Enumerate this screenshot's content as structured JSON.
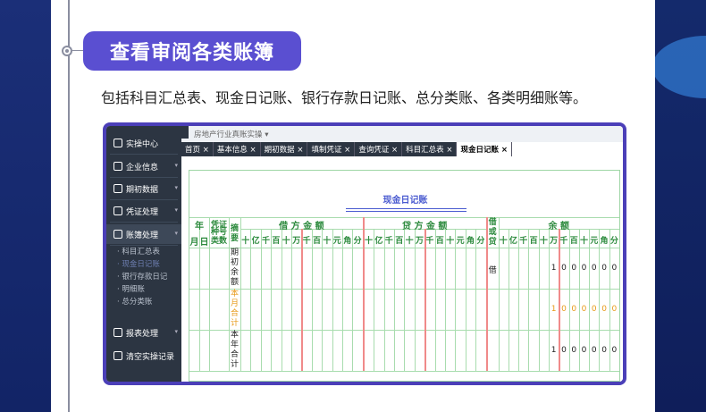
{
  "section": {
    "title": "查看审阅各类账簿",
    "description": "包括科目汇总表、现金日记账、银行存款日记账、总分类账、各类明细账等。"
  },
  "colors": {
    "pill": "#5a4fd1",
    "frame": "#4b3fb8",
    "sidebar": "#2c3542",
    "header_green": "#2c8a3d",
    "title_blue": "#4a5bd0",
    "orange": "#e89a1a"
  },
  "app": {
    "sidebar": {
      "items": [
        {
          "label": "实操中心",
          "icon": "monitor-icon",
          "arrow": ""
        },
        {
          "label": "企业信息",
          "icon": "users-icon",
          "arrow": "▾"
        },
        {
          "label": "期初数据",
          "icon": "bar-chart-icon",
          "arrow": "▾"
        },
        {
          "label": "凭证处理",
          "icon": "voucher-icon",
          "arrow": "▾"
        },
        {
          "label": "账簿处理",
          "icon": "book-icon",
          "arrow": "▾"
        }
      ],
      "subitems": [
        "科目汇总表",
        "现金日记账",
        "银行存款日记",
        "明细账",
        "总分类账"
      ],
      "bottom_items": [
        {
          "label": "报表处理",
          "icon": "chart-line-icon",
          "arrow": "▾"
        },
        {
          "label": "清空实操记录",
          "icon": "clear-icon",
          "arrow": ""
        }
      ]
    },
    "breadcrumb": "房地产行业真账实操 ▾",
    "tabs": [
      "首页 ×",
      "基本信息 ×",
      "期初数据 ×",
      "填制凭证 ×",
      "查询凭证 ×",
      "科目汇总表 ×",
      "现金日记账 ×"
    ],
    "ledger": {
      "title": "现金日记账",
      "headers": {
        "year": "年",
        "month": "月",
        "day": "日",
        "voucher": "凭证",
        "voucher_sub": "种号类数",
        "summary": "摘要",
        "debit": "借 方 金 额",
        "credit": "贷 方 金 额",
        "direction": "借或贷",
        "balance": "余 额"
      },
      "digit_headers": [
        "十",
        "亿",
        "千",
        "百",
        "十",
        "万",
        "千",
        "百",
        "十",
        "元",
        "角",
        "分"
      ],
      "rows": [
        {
          "summary": "期初余额",
          "direction": "借",
          "balance": [
            "1",
            "0",
            "0",
            "0",
            "0",
            "0",
            "0"
          ],
          "highlight": false
        },
        {
          "summary": "本月合计",
          "direction": "",
          "balance": [
            "1",
            "0",
            "0",
            "0",
            "0",
            "0",
            "0"
          ],
          "highlight": true
        },
        {
          "summary": "本年合计",
          "direction": "",
          "balance": [
            "1",
            "0",
            "0",
            "0",
            "0",
            "0",
            "0"
          ],
          "highlight": false
        }
      ]
    }
  }
}
